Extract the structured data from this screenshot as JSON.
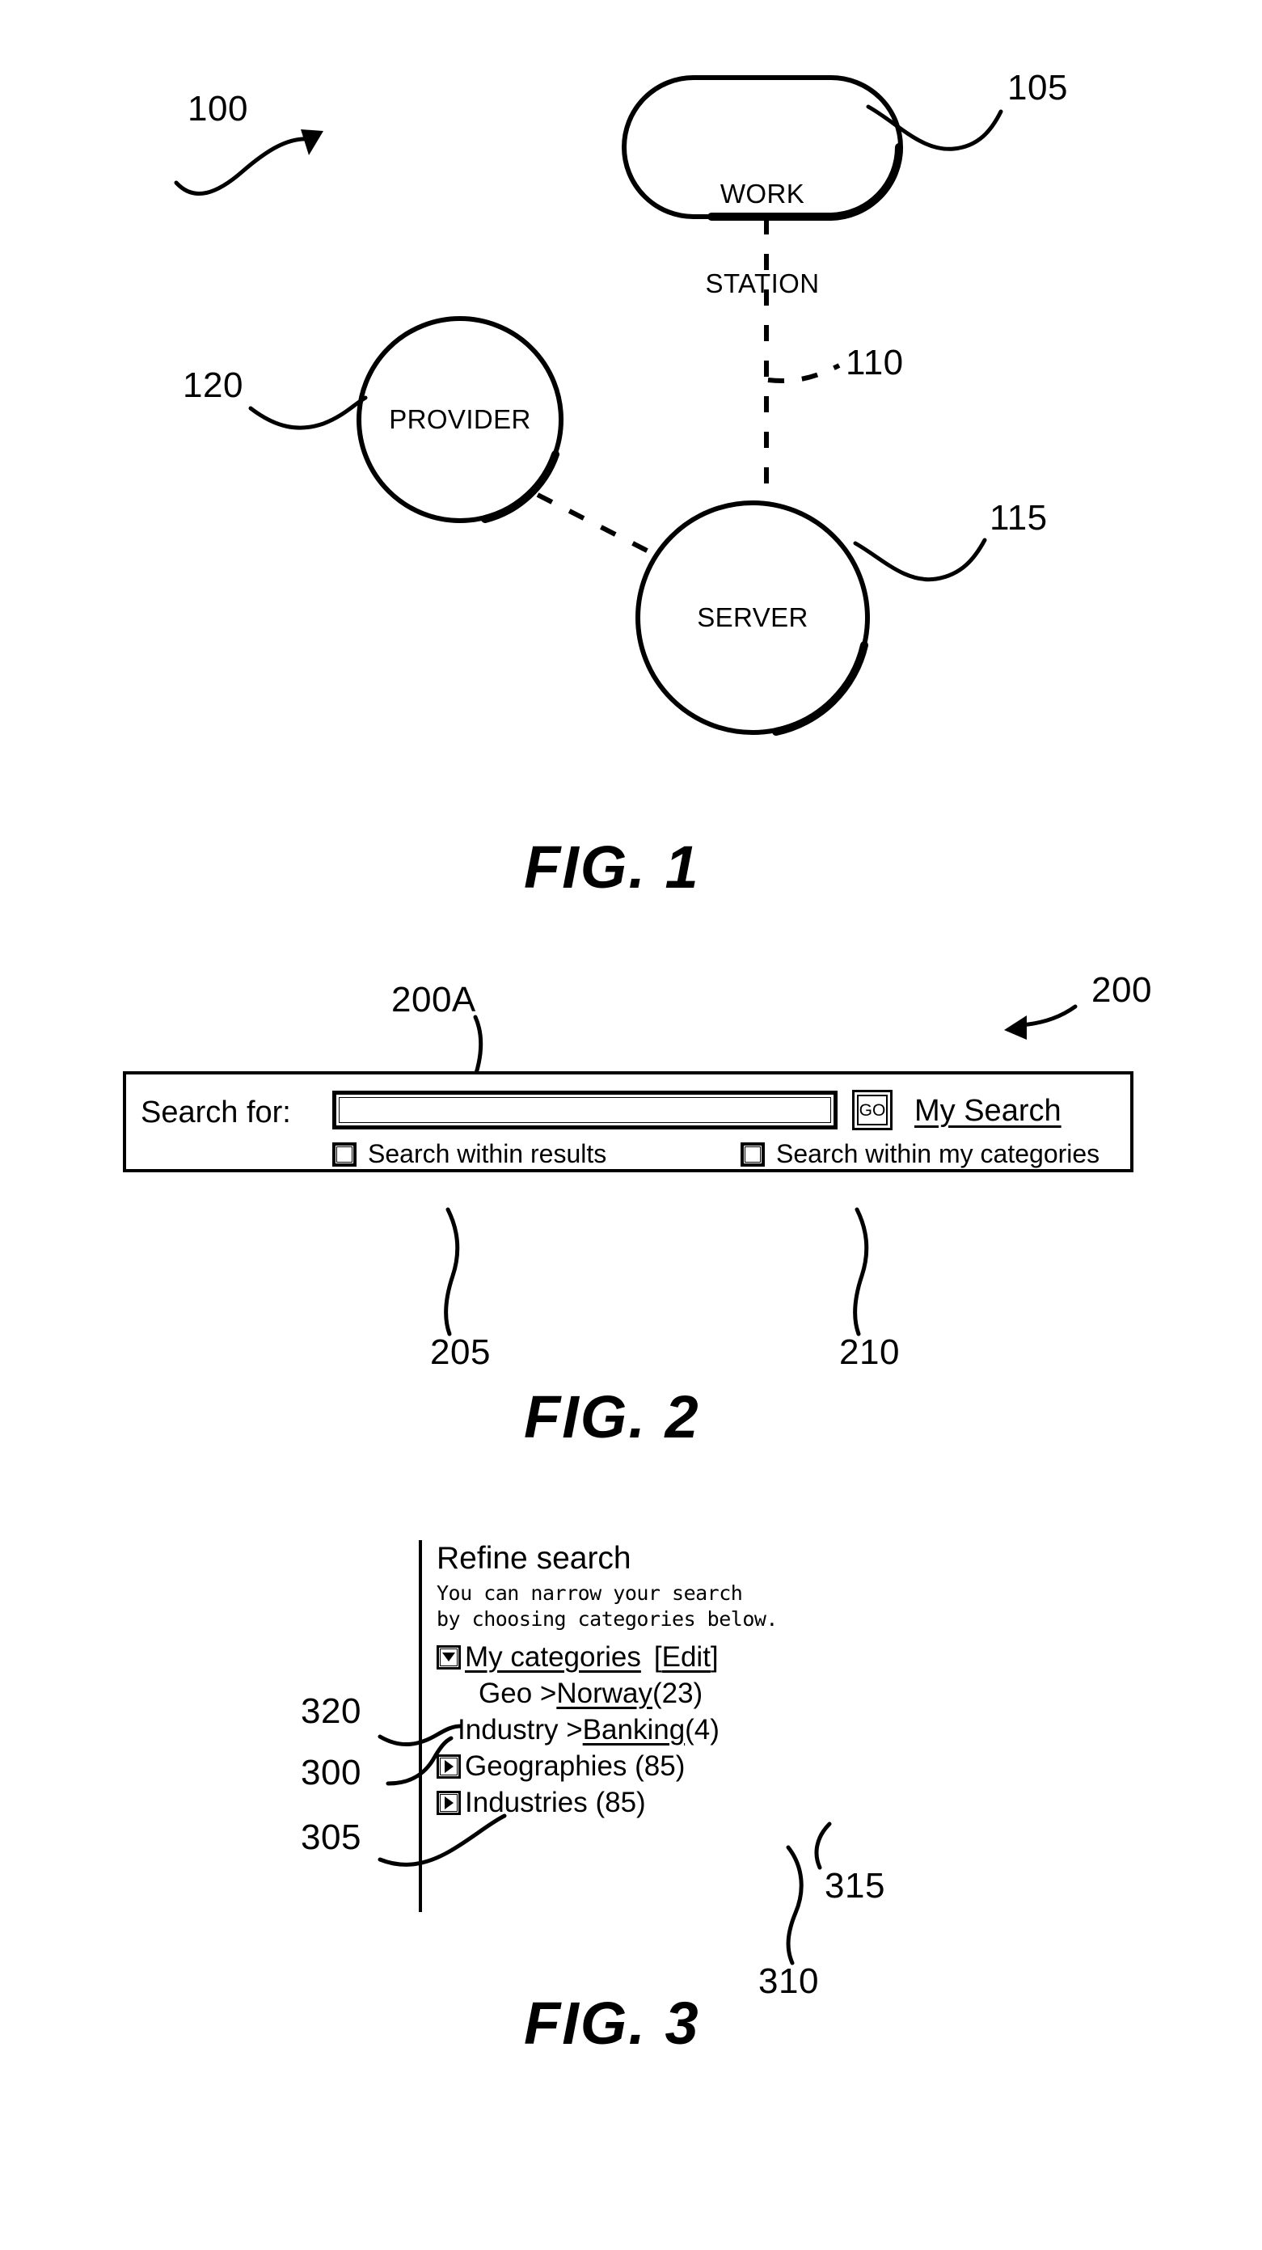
{
  "document": {
    "type": "patent-drawing-sheet"
  },
  "fig1": {
    "caption": "FIG. 1",
    "system_ref": "100",
    "nodes": [
      {
        "id": "workstation",
        "label_line1": "WORK",
        "label_line2": "STATION",
        "ref": "105",
        "shape": "stadium"
      },
      {
        "id": "server",
        "label_line1": "SERVER",
        "label_line2": "",
        "ref": "115",
        "shape": "circle"
      },
      {
        "id": "provider",
        "label_line1": "PROVIDER",
        "label_line2": "",
        "ref": "120",
        "shape": "circle"
      }
    ],
    "link_ref": "110",
    "link_style": "dashed"
  },
  "fig2": {
    "caption": "FIG. 2",
    "panel_ref": "200",
    "input_ref": "200A",
    "search_label": "Search for:",
    "search_value": "",
    "search_placeholder": "",
    "go_label": "GO",
    "my_search_label": "My Search",
    "checkboxes": [
      {
        "label": "Search within results",
        "ref": "205",
        "checked": false
      },
      {
        "label": "Search within my categories",
        "ref": "210",
        "checked": false
      }
    ]
  },
  "fig3": {
    "caption": "FIG. 3",
    "title": "Refine search",
    "subtitle_line1": "You can narrow your search",
    "subtitle_line2": "by choosing categories below.",
    "my_categories": {
      "label": "My categories",
      "edit_open": "[",
      "edit_label": "Edit",
      "edit_close": "]",
      "toggle_icon": "triangle-down-icon",
      "ref": "320"
    },
    "saved_categories": [
      {
        "prefix": "Geo > ",
        "link": "Norway",
        "count": "(23)",
        "ref": "300"
      },
      {
        "prefix": "Industry > ",
        "link": "Banking",
        "count": "(4)",
        "ref": "305"
      }
    ],
    "browse_categories": [
      {
        "label": "Geographies (85)",
        "toggle_icon": "triangle-right-icon",
        "ref": "315"
      },
      {
        "label": "Industries (85)",
        "toggle_icon": "triangle-right-icon",
        "ref": "310"
      }
    ]
  }
}
